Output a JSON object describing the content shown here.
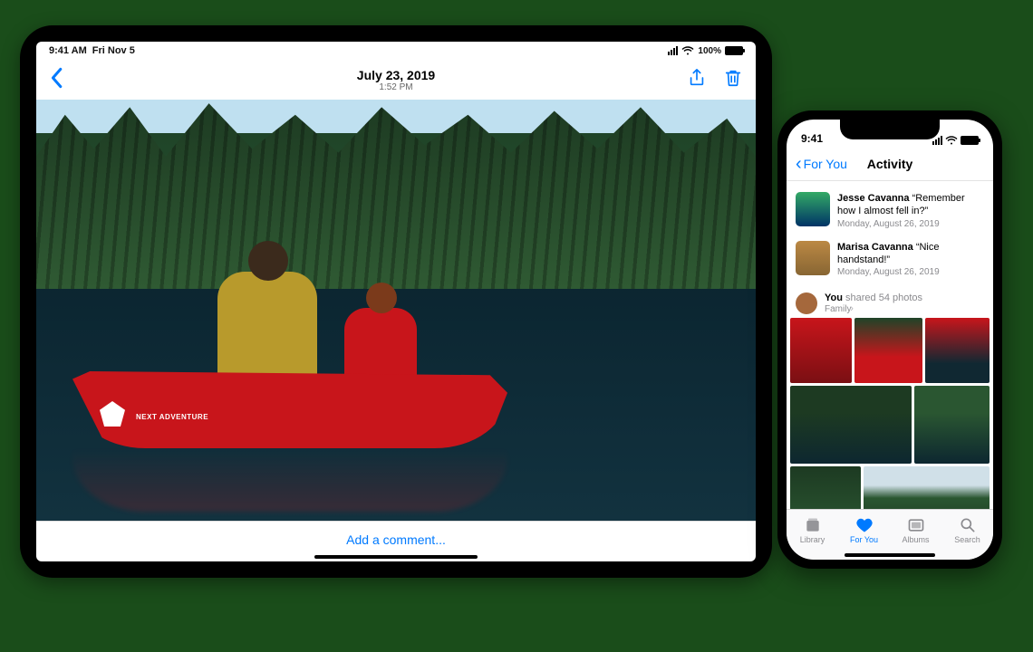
{
  "ipad": {
    "status": {
      "time": "9:41 AM",
      "date": "Fri Nov 5",
      "battery_pct": "100%"
    },
    "header": {
      "date": "July 23, 2019",
      "time": "1:52 PM"
    },
    "photo": {
      "logo_text": "NEXT ADVENTURE"
    },
    "footer": {
      "comment_placeholder": "Add a comment..."
    }
  },
  "iphone": {
    "status": {
      "time": "9:41"
    },
    "header": {
      "back_label": "For You",
      "title": "Activity"
    },
    "activity": [
      {
        "name": "Jesse Cavanna",
        "quote": "“Remember how I almost fell in?”",
        "date": "Monday, August 26, 2019"
      },
      {
        "name": "Marisa Cavanna",
        "quote": "“Nice handstand!”",
        "date": "Monday, August 26, 2019"
      }
    ],
    "shared": {
      "you": "You",
      "rest": " shared 54 photos",
      "album": "Family"
    },
    "tabs": [
      {
        "label": "Library"
      },
      {
        "label": "For You"
      },
      {
        "label": "Albums"
      },
      {
        "label": "Search"
      }
    ]
  }
}
